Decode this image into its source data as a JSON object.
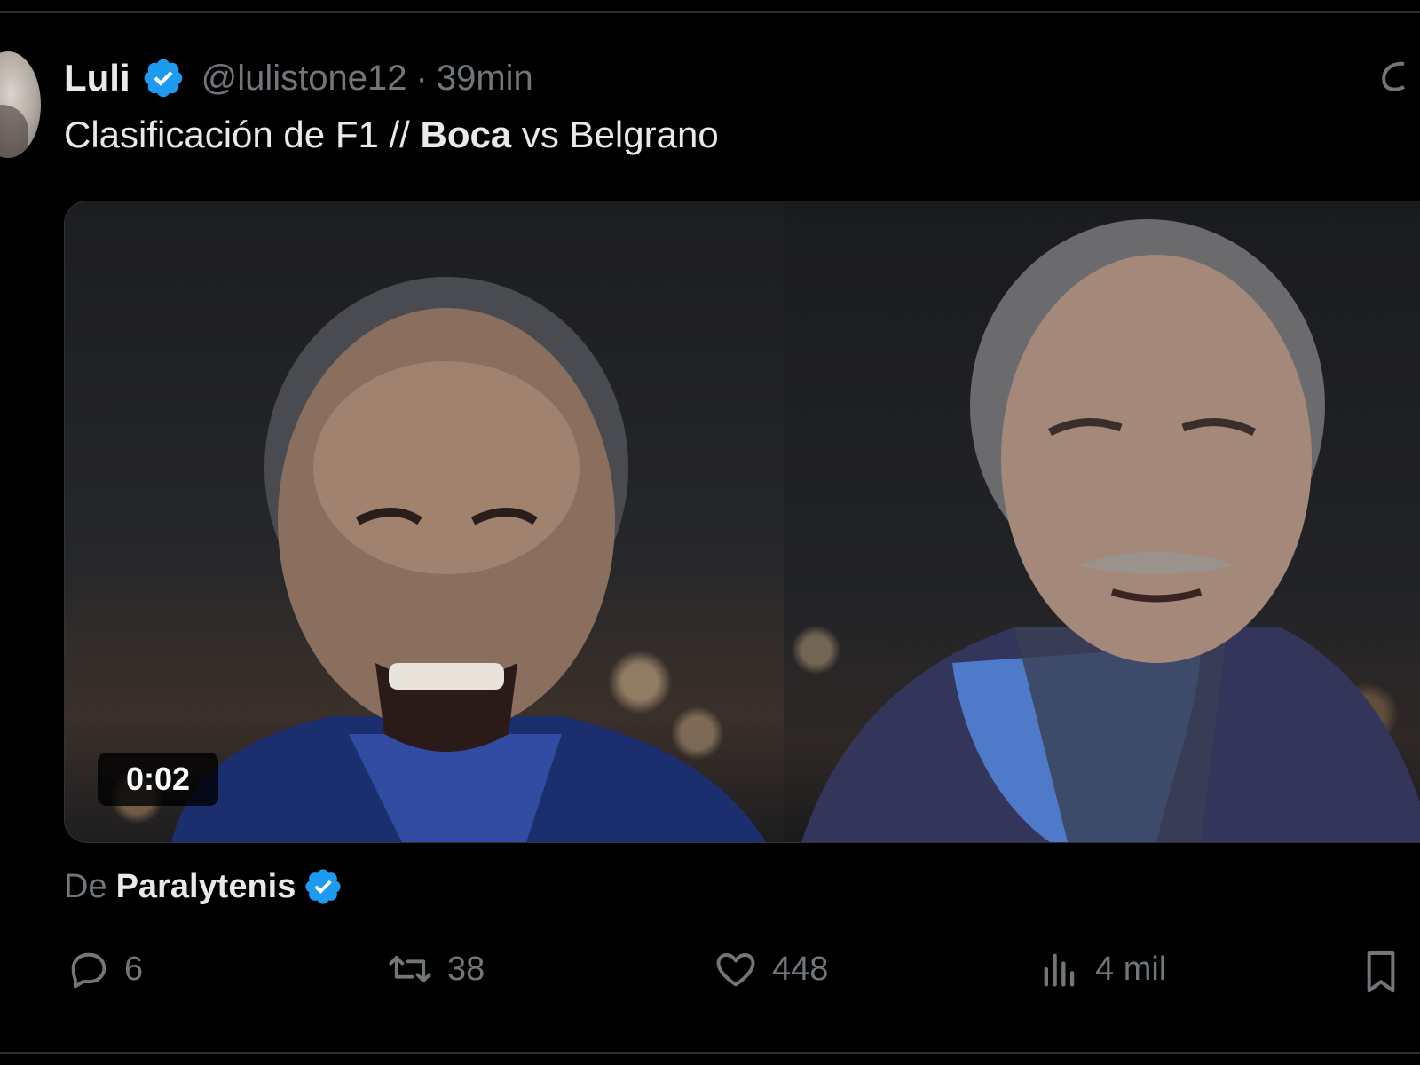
{
  "tweet": {
    "author_name": "Luli",
    "handle": "@lulistone12",
    "separator": "·",
    "time": "39min",
    "text_part1": "Clasificación de F1 // ",
    "text_bold": "Boca",
    "text_part2": " vs Belgrano"
  },
  "media": {
    "duration": "0:02"
  },
  "source": {
    "prefix": "De",
    "account": "Paralytenis"
  },
  "actions": {
    "replies": "6",
    "retweets": "38",
    "likes": "448",
    "views": "4 mil"
  },
  "colors": {
    "background": "#000000",
    "text_primary": "#e7e9ea",
    "text_secondary": "#71767b",
    "verified": "#1d9bf0"
  },
  "icons": {
    "verified": "verified-badge-icon",
    "more": "grok-icon",
    "reply": "reply-icon",
    "retweet": "retweet-icon",
    "like": "heart-icon",
    "views": "views-icon",
    "bookmark": "bookmark-icon"
  }
}
